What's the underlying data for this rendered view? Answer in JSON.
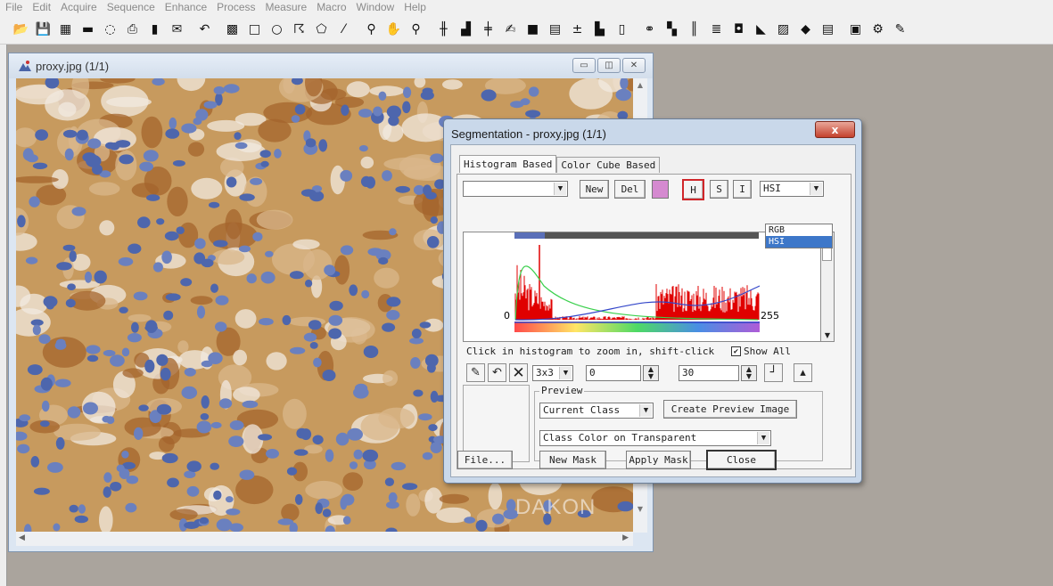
{
  "menubar": [
    "File",
    "Edit",
    "Acquire",
    "Sequence",
    "Enhance",
    "Process",
    "Measure",
    "Macro",
    "Window",
    "Help"
  ],
  "toolbar": {
    "groups": [
      [
        "open-icon",
        "save-icon",
        "thumbnails-icon",
        "video-icon",
        "lasso-icon",
        "print-icon",
        "book-icon",
        "envelope-icon"
      ],
      [
        "undo-icon"
      ],
      [
        "new-aoi-icon",
        "rectangle-icon",
        "ellipse-icon",
        "freeform-icon",
        "polygon-icon",
        "wand-icon"
      ],
      [
        "zoom-icon",
        "pan-icon",
        "zoom-out-icon"
      ],
      [
        "calibrate-icon",
        "bar-chart-icon",
        "grid-icon",
        "signature-icon",
        "color-square-icon",
        "pattern-icon",
        "plus-minus-icon",
        "histogram-icon",
        "gray-bar-icon"
      ],
      [
        "link-icon",
        "statistics-icon",
        "align-icon",
        "text-align-icon",
        "camera-icon",
        "line-chart-icon",
        "map-icon",
        "cube-icon",
        "film-icon"
      ],
      [
        "composite-icon",
        "macro-icon",
        "edit-icon"
      ]
    ]
  },
  "image_window": {
    "title": "proxy.jpg (1/1)",
    "buttons": [
      "minimize-icon",
      "maximize-icon",
      "close-icon"
    ],
    "watermark": "DAKON"
  },
  "segmentation": {
    "title": "Segmentation - proxy.jpg (1/1)",
    "close_label": "x",
    "tabs": [
      "Histogram Based",
      "Color Cube Based"
    ],
    "class_value": "",
    "new_label": "New",
    "del_label": "Del",
    "channel_buttons": [
      "H",
      "S",
      "I"
    ],
    "selected_channel": "H",
    "colorspace": {
      "value": "HSI",
      "options": [
        "RGB",
        "HSI"
      ],
      "selected": "HSI"
    },
    "class_color": "#d58ad0",
    "histogram": {
      "min_label": "0",
      "max_label": "255",
      "range_start": 0,
      "range_end": 30
    },
    "hint": "Click in histogram to zoom in, shift-click",
    "show_all_label": "Show All",
    "show_all_checked": true,
    "kernel": {
      "value": "3x3"
    },
    "low_value": "0",
    "high_value": "30",
    "preview": {
      "group_label": "Preview",
      "class_value": "Current Class",
      "create_label": "Create Preview Image",
      "mode_value": "Class Color on Transparent"
    },
    "footer": {
      "file_label": "File...",
      "new_mask_label": "New Mask",
      "apply_mask_label": "Apply Mask",
      "close_label": "Close"
    }
  },
  "colors": {
    "stain_brown": "#b37b3d",
    "nucleus_blue": "#4d66ad",
    "histogram_red": "#e00000",
    "curve_green": "#3bd04d",
    "curve_blue": "#3346c9",
    "range_bar": "#5a6fb8"
  }
}
